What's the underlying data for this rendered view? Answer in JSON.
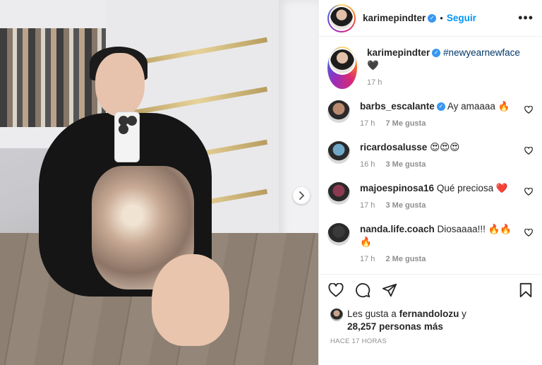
{
  "post": {
    "username": "karimepindter",
    "follow_label": "Seguir",
    "separator": "•",
    "more_label": "•••",
    "caption": {
      "hashtag": "#newyearnewface",
      "emoji": "🖤",
      "time": "17 h"
    }
  },
  "comments": [
    {
      "username": "barbs_escalante",
      "verified": true,
      "text": "Ay amaaaa 🔥",
      "time": "17 h",
      "likes": "7 Me gusta",
      "avatar_color": "#b98a6f"
    },
    {
      "username": "ricardosalusse",
      "verified": false,
      "text": "😍😍😍",
      "time": "16 h",
      "likes": "3 Me gusta",
      "avatar_color": "#6fa7c8"
    },
    {
      "username": "majoespinosa16",
      "verified": false,
      "text": "Qué preciosa ❤️",
      "time": "17 h",
      "likes": "3 Me gusta",
      "avatar_color": "#8b3a52"
    },
    {
      "username": "nanda.life.coach",
      "verified": false,
      "text": "Diosaaaa!!! 🔥🔥🔥",
      "time": "17 h",
      "likes": "2 Me gusta",
      "avatar_color": "#3a3a3a"
    }
  ],
  "likes": {
    "prefix": "Les gusta a",
    "user": "fernandolozu",
    "suffix": "y",
    "count": "28,257 personas más"
  },
  "posted_ago": "HACE 17 HORAS",
  "icons": {
    "like": "heart-icon",
    "comment": "comment-icon",
    "share": "share-icon",
    "save": "bookmark-icon",
    "next": "chevron-right-icon"
  },
  "colors": {
    "link": "#0095f6",
    "hashtag": "#00376b",
    "muted": "#8e8e8e",
    "verified": "#3897f0"
  }
}
